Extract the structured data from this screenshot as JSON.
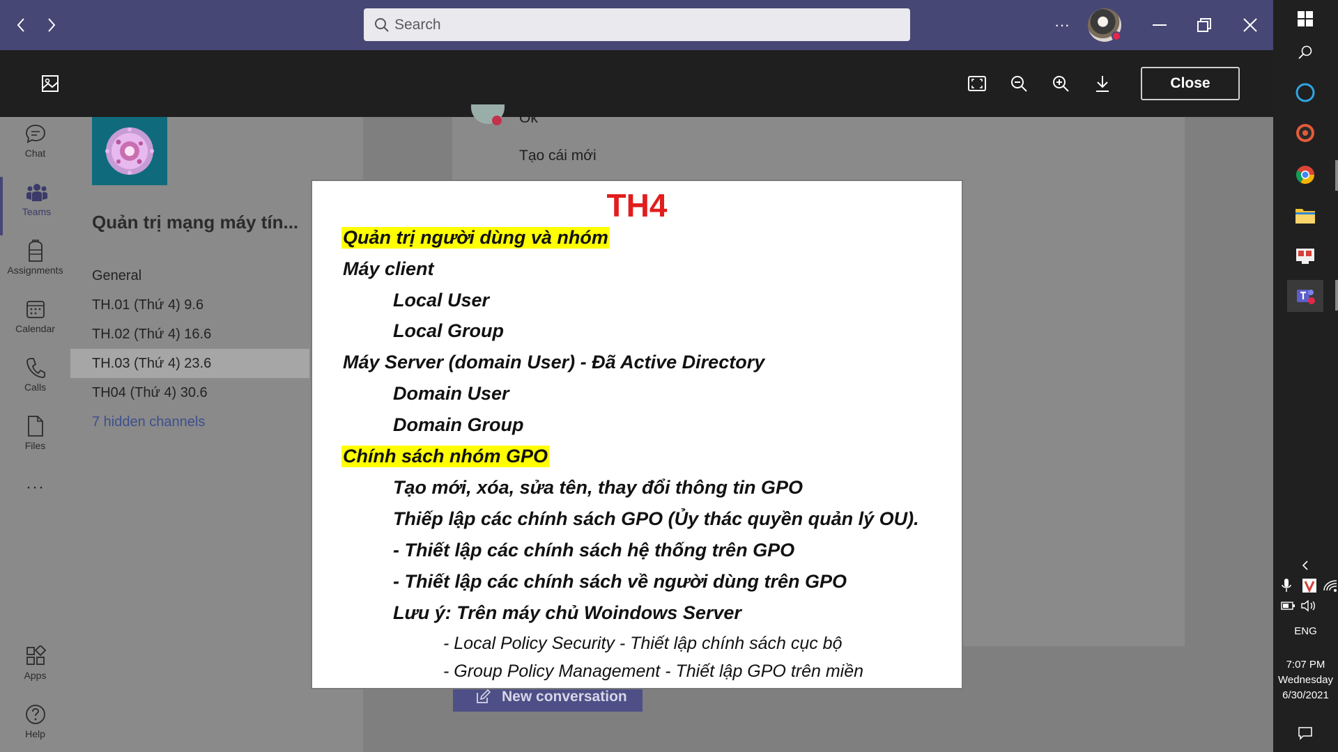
{
  "titlebar": {
    "search_placeholder": "Search",
    "more_label": "···"
  },
  "viewer": {
    "close_label": "Close"
  },
  "rail": {
    "items": [
      {
        "label": "Chat",
        "icon": "chat-icon"
      },
      {
        "label": "Teams",
        "icon": "teams-icon"
      },
      {
        "label": "Assignments",
        "icon": "assignments-icon"
      },
      {
        "label": "Calendar",
        "icon": "calendar-icon"
      },
      {
        "label": "Calls",
        "icon": "calls-icon"
      },
      {
        "label": "Files",
        "icon": "files-icon"
      },
      {
        "label": "Apps",
        "icon": "apps-icon"
      },
      {
        "label": "Help",
        "icon": "help-icon"
      }
    ],
    "more": "···",
    "active": "Teams"
  },
  "team": {
    "name": "Quản trị mạng máy tín...",
    "channels": [
      {
        "label": "General"
      },
      {
        "label": "TH.01 (Thứ 4) 9.6"
      },
      {
        "label": "TH.02 (Thứ 4) 16.6"
      },
      {
        "label": "TH.03 (Thứ 4) 23.6"
      },
      {
        "label": "TH04 (Thứ 4) 30.6"
      }
    ],
    "selected_channel": "TH.03 (Thứ 4) 23.6",
    "hidden_channels": "7 hidden channels"
  },
  "conversation": {
    "message_1": "Ok",
    "message_2": "Tạo cái mới",
    "new_conversation": "New conversation"
  },
  "preview": {
    "title": "TH4",
    "lines": [
      "Quản trị người dùng và nhóm",
      "Máy client",
      "Local User",
      "Local Group",
      "Máy Server (domain User) - Đã Active Directory",
      "Domain User",
      "Domain Group",
      "Chính sách nhóm GPO",
      "Tạo mới, xóa, sửa tên, thay đổi thông tin GPO",
      "Thiếp lập các chính sách GPO (Ủy thác quyền quản lý OU).",
      "- Thiết lập các chính sách hệ thống trên GPO",
      "- Thiết lập các chính sách về người dùng trên GPO",
      "Lưu ý: Trên máy chủ Woindows Server",
      "- Local Policy Security - Thiết lập chính sách cục bộ",
      "- Group Policy Management - Thiết lập GPO trên miền"
    ],
    "highlight_color": "#ffff00",
    "title_color": "#e11d1d"
  },
  "taskbar": {
    "language": "ENG",
    "time": "7:07 PM",
    "day": "Wednesday",
    "date": "6/30/2021"
  }
}
